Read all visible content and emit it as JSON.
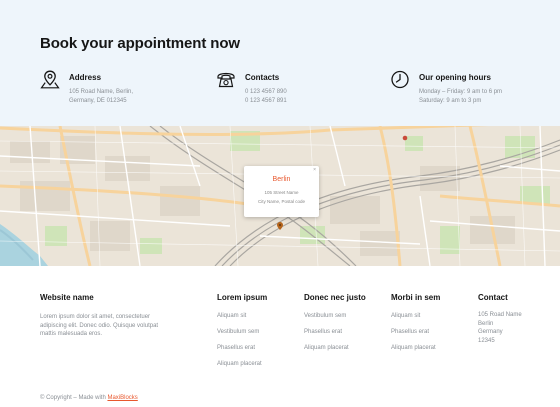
{
  "heading": "Book your appointment now",
  "info": {
    "address": {
      "title": "Address",
      "line1": "105 Road Name, Berlin,",
      "line2": "Germany, DE 012345",
      "icon": "map-pin-icon"
    },
    "contacts": {
      "title": "Contacts",
      "line1": "0 123 4567 890",
      "line2": "0 123 4567 891",
      "icon": "phone-icon"
    },
    "hours": {
      "title": "Our opening hours",
      "line1": "Monday – Friday: 9 am to 6 pm",
      "line2": "Saturday: 9 am to 3 pm",
      "icon": "clock-icon"
    }
  },
  "map": {
    "popup": {
      "city": "Berlin",
      "line1": "105 Street Name",
      "line2": "City Name, Postal code",
      "close": "×"
    }
  },
  "footer": {
    "about": {
      "title": "Website name",
      "line1": "Lorem ipsum dolor sit amet, consectetuer",
      "line2": "adipiscing elit. Donec odio. Quisque volutpat",
      "line3": "mattis malesuada eros."
    },
    "col1": {
      "title": "Lorem ipsum",
      "items": [
        "Aliquam sit",
        "Vestibulum sem",
        "Phasellus erat",
        "Aliquam placerat"
      ]
    },
    "col2": {
      "title": "Donec nec justo",
      "items": [
        "Vestibulum sem",
        "Phasellus erat",
        "Aliquam placerat"
      ]
    },
    "col3": {
      "title": "Morbi in sem",
      "items": [
        "Aliquam sit",
        "Phasellus erat",
        "Aliquam placerat"
      ]
    },
    "contact": {
      "title": "Contact",
      "items": [
        "105 Road Name",
        "Berlin",
        "Germany",
        "12345"
      ]
    }
  },
  "copyright": {
    "prefix": "© Copyright – Made with ",
    "link": "MaxiBlocks"
  },
  "colors": {
    "accent": "#e8582e",
    "top_bg": "#eef5fb"
  }
}
